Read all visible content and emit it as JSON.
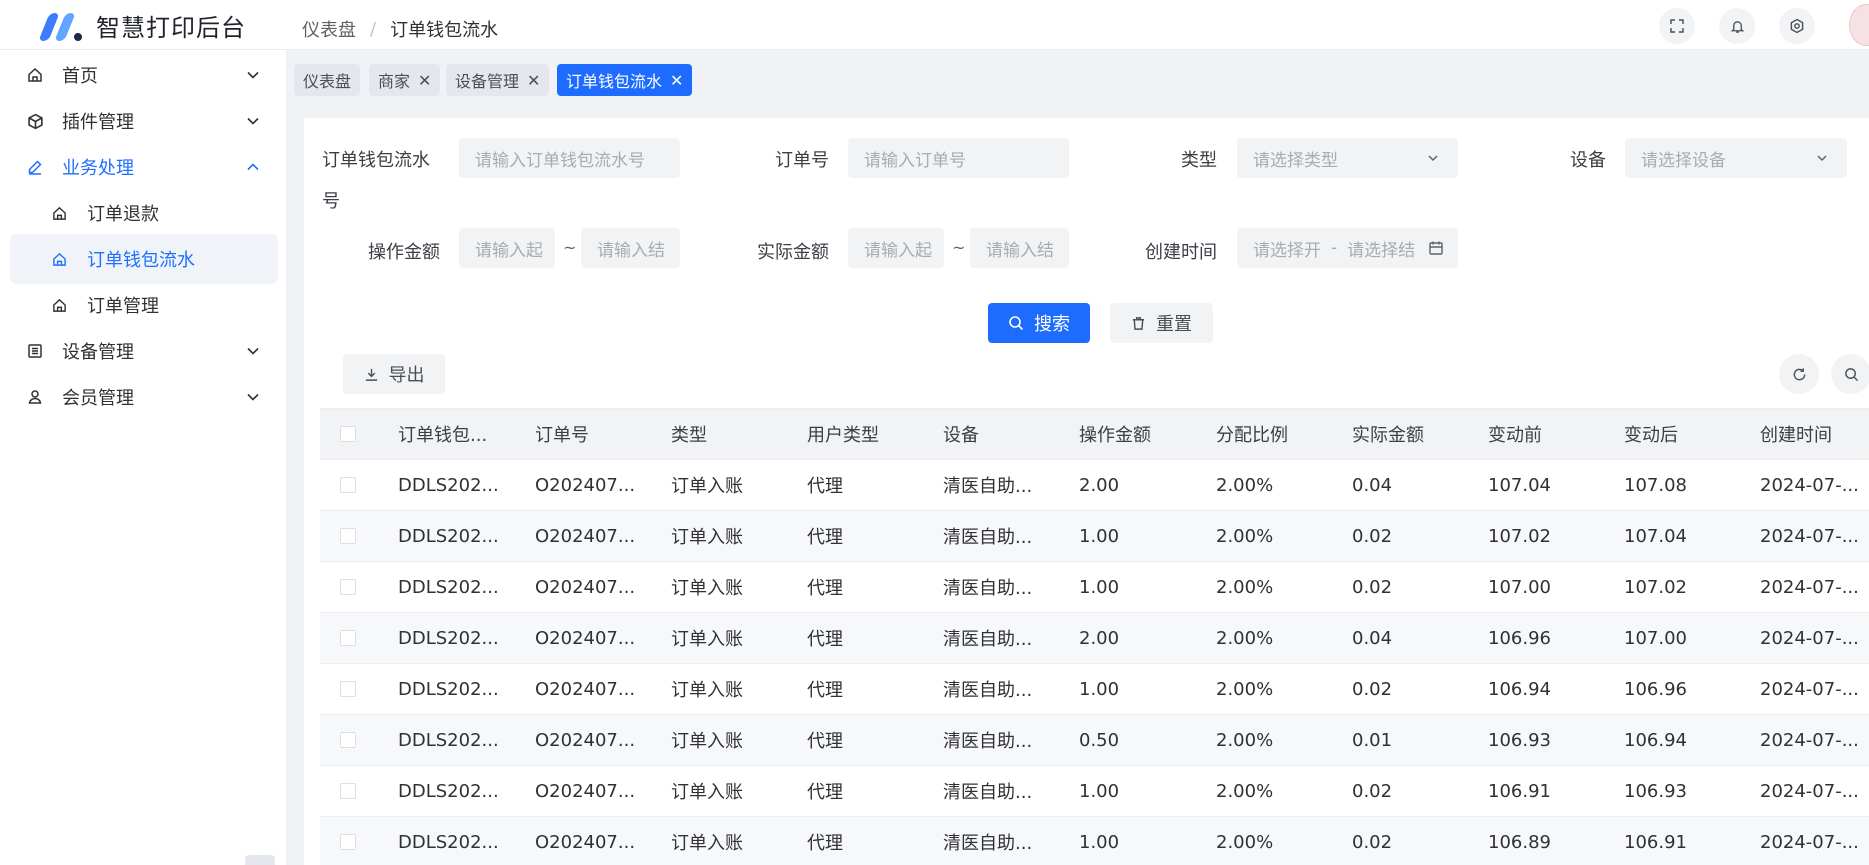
{
  "app": {
    "title": "智慧打印后台"
  },
  "breadcrumb": {
    "first": "仪表盘",
    "sep": "/",
    "current": "订单钱包流水"
  },
  "sidebar": {
    "items": [
      {
        "label": "首页",
        "icon": "home-icon",
        "expanded": false
      },
      {
        "label": "插件管理",
        "icon": "plugin-cube-icon",
        "expanded": false
      },
      {
        "label": "业务处理",
        "icon": "edit-pen-icon",
        "expanded": true
      },
      {
        "label": "订单退款",
        "icon": "home-icon",
        "sub": true
      },
      {
        "label": "订单钱包流水",
        "icon": "home-icon",
        "sub": true,
        "active": true
      },
      {
        "label": "订单管理",
        "icon": "home-icon",
        "sub": true
      },
      {
        "label": "设备管理",
        "icon": "list-icon",
        "expanded": false
      },
      {
        "label": "会员管理",
        "icon": "user-icon",
        "expanded": false
      }
    ]
  },
  "tabs": [
    {
      "label": "仪表盘",
      "closable": false
    },
    {
      "label": "商家",
      "closable": true
    },
    {
      "label": "设备管理",
      "closable": true
    },
    {
      "label": "订单钱包流水",
      "closable": true,
      "active": true
    }
  ],
  "tab_close_glyph": "✕",
  "filters": {
    "flow_no": {
      "label_line1": "订单钱包流水",
      "label_line2": "号",
      "placeholder": "请输入订单钱包流水号"
    },
    "order_no": {
      "label": "订单号",
      "placeholder": "请输入订单号"
    },
    "type": {
      "label": "类型",
      "placeholder": "请选择类型"
    },
    "device": {
      "label": "设备",
      "placeholder": "请选择设备"
    },
    "op_amount": {
      "label": "操作金额",
      "start_placeholder": "请输入起",
      "end_placeholder": "请输入结",
      "tilde": "~"
    },
    "real_amount": {
      "label": "实际金额",
      "start_placeholder": "请输入起",
      "end_placeholder": "请输入结",
      "tilde": "~"
    },
    "created": {
      "label": "创建时间",
      "start_placeholder": "请选择开",
      "dash": "-",
      "end_placeholder": "请选择结"
    }
  },
  "actions": {
    "search": "搜索",
    "reset": "重置",
    "export": "导出"
  },
  "colors": {
    "primary": "#1d6bff",
    "active_text": "#1f6fff"
  },
  "table": {
    "columns": [
      "订单钱包...",
      "订单号",
      "类型",
      "用户类型",
      "设备",
      "操作金额",
      "分配比例",
      "实际金额",
      "变动前",
      "变动后",
      "创建时间"
    ],
    "rows": [
      [
        "DDLS202...",
        "O202407...",
        "订单入账",
        "代理",
        "清医自助...",
        "2.00",
        "2.00%",
        "0.04",
        "107.04",
        "107.08",
        "2024-07-..."
      ],
      [
        "DDLS202...",
        "O202407...",
        "订单入账",
        "代理",
        "清医自助...",
        "1.00",
        "2.00%",
        "0.02",
        "107.02",
        "107.04",
        "2024-07-..."
      ],
      [
        "DDLS202...",
        "O202407...",
        "订单入账",
        "代理",
        "清医自助...",
        "1.00",
        "2.00%",
        "0.02",
        "107.00",
        "107.02",
        "2024-07-..."
      ],
      [
        "DDLS202...",
        "O202407...",
        "订单入账",
        "代理",
        "清医自助...",
        "2.00",
        "2.00%",
        "0.04",
        "106.96",
        "107.00",
        "2024-07-..."
      ],
      [
        "DDLS202...",
        "O202407...",
        "订单入账",
        "代理",
        "清医自助...",
        "1.00",
        "2.00%",
        "0.02",
        "106.94",
        "106.96",
        "2024-07-..."
      ],
      [
        "DDLS202...",
        "O202407...",
        "订单入账",
        "代理",
        "清医自助...",
        "0.50",
        "2.00%",
        "0.01",
        "106.93",
        "106.94",
        "2024-07-..."
      ],
      [
        "DDLS202...",
        "O202407...",
        "订单入账",
        "代理",
        "清医自助...",
        "1.00",
        "2.00%",
        "0.02",
        "106.91",
        "106.93",
        "2024-07-..."
      ],
      [
        "DDLS202...",
        "O202407...",
        "订单入账",
        "代理",
        "清医自助...",
        "1.00",
        "2.00%",
        "0.02",
        "106.89",
        "106.91",
        "2024-07-..."
      ]
    ]
  }
}
